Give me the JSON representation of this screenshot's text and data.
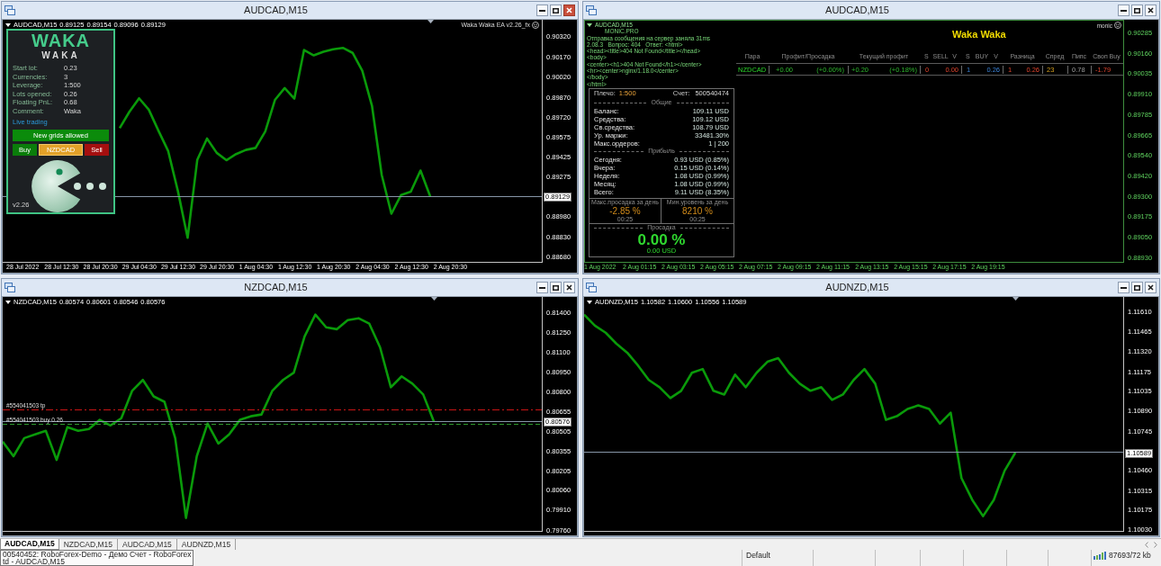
{
  "windows": [
    {
      "kind": "chart",
      "title": "AUDCAD,M15",
      "active": true,
      "header": {
        "symbol": "AUDCAD,M15",
        "ohlc": [
          "0.89125",
          "0.89154",
          "0.89096",
          "0.89129"
        ]
      },
      "ea_label": "Waka Waka EA v2.26_fx",
      "ea_panel": {
        "logo": "WAKA",
        "subtitle": "WAKA",
        "rows": [
          {
            "label": "Start lot:",
            "value": "0.23"
          },
          {
            "label": "Currencies:",
            "value": "3"
          },
          {
            "label": "Leverage:",
            "value": "1:500"
          },
          {
            "label": "Lots opened:",
            "value": "0.26"
          },
          {
            "label": "Floating PnL:",
            "value": "0.68"
          },
          {
            "label": "Comment:",
            "value": "Waka"
          }
        ],
        "status": "Live trading",
        "grid_button": "New grids allowed",
        "buttons": [
          {
            "kind": "buy",
            "label": "Buy"
          },
          {
            "kind": "symbol",
            "label": "NZDCAD"
          },
          {
            "kind": "sell",
            "label": "Sell"
          }
        ],
        "version": "v2.26"
      },
      "chart_data": {
        "type": "line",
        "categories": [
          "28 Jul 2022",
          null,
          null,
          null,
          "28 Jul 12:30",
          null,
          null,
          null,
          "28 Jul 20:30",
          null,
          null,
          null,
          "29 Jul 04:30",
          null,
          null,
          null,
          "29 Jul 12:30",
          null,
          null,
          null,
          "29 Jul 20:30",
          null,
          null,
          null,
          "1 Aug 04:30",
          null,
          null,
          null,
          "1 Aug 12:30",
          null,
          null,
          null,
          "1 Aug 20:30",
          null,
          null,
          null,
          "2 Aug 04:30",
          null,
          null,
          null,
          "2 Aug 12:30",
          null,
          null,
          null,
          "2 Aug 20:30",
          null,
          null,
          null,
          null,
          null,
          null,
          null,
          null,
          null
        ],
        "series": [
          {
            "color": "#0a9a0a",
            "values": [
              null,
              null,
              null,
              null,
              null,
              null,
              null,
              null,
              null,
              null,
              0.8964,
              0.89762,
              0.89863,
              0.89778,
              0.8962,
              0.89468,
              0.89169,
              0.8882,
              0.89404,
              0.89562,
              0.89455,
              0.894,
              0.89446,
              0.89477,
              0.89492,
              0.89615,
              0.89851,
              0.89939,
              0.89861,
              0.90224,
              0.90184,
              0.90211,
              0.9023,
              0.9024,
              0.90203,
              0.90069,
              0.89807,
              0.89291,
              0.89,
              0.8914,
              0.89165,
              0.89323,
              0.89129,
              null,
              null,
              null,
              null,
              null,
              null,
              null,
              null,
              null,
              null,
              null
            ]
          }
        ],
        "ylim": [
          0.8864,
          0.9045
        ],
        "yticks": [
          {
            "value": 0.9032,
            "label": "0.90320"
          },
          {
            "value": 0.9017,
            "label": "0.90170"
          },
          {
            "value": 0.9002,
            "label": "0.90020"
          },
          {
            "value": 0.8987,
            "label": "0.89870"
          },
          {
            "value": 0.8972,
            "label": "0.89720"
          },
          {
            "value": 0.89575,
            "label": "0.89575"
          },
          {
            "value": 0.89425,
            "label": "0.89425"
          },
          {
            "value": 0.89275,
            "label": "0.89275"
          },
          {
            "value": 0.8898,
            "label": "0.88980"
          },
          {
            "value": 0.8883,
            "label": "0.88830"
          },
          {
            "value": 0.8868,
            "label": "0.88680"
          }
        ],
        "ref_lines": [
          {
            "axis": "y",
            "value": 0.89129,
            "label": "0.89129",
            "color": "#8796a8"
          }
        ]
      }
    },
    {
      "kind": "monitor",
      "title": "AUDCAD,M15",
      "active": false,
      "header": {
        "symbol": "AUDCAD,M15"
      },
      "brand": "MONIC.PRO",
      "log": [
        "Отправка сообщения на сервер заняла 31ms",
        "2.08.3   Вопрос: 404   Ответ: <html>",
        "<head><title>404 Not Found</title></head>",
        "<body>",
        "<center><h1>404 Not Found</h1></center>",
        "<hr><center>nginx/1.18.0</center>",
        "</body>",
        "</html>"
      ],
      "stats": {
        "leverage_label": "Плечо:",
        "leverage": "1:500",
        "account_label": "Счет:",
        "account": "500540474",
        "sections": [
          {
            "title": "Общие",
            "rows": [
              {
                "label": "Баланс:",
                "value": "109.11 USD"
              },
              {
                "label": "Средства:",
                "value": "109.12 USD"
              },
              {
                "label": "Св.средства:",
                "value": "108.79 USD"
              },
              {
                "label": "Ур. маржи:",
                "value": "33481.30%"
              },
              {
                "label": "Макс.ордеров:",
                "value": "1 | 200"
              }
            ]
          },
          {
            "title": "Прибыль",
            "rows": [
              {
                "label": "Сегодня:",
                "value": "0.93 USD (0.85%)"
              },
              {
                "label": "Вчера:",
                "value": "0.15 USD (0.14%)"
              },
              {
                "label": "Неделя:",
                "value": "1.08 USD (0.99%)"
              },
              {
                "label": "Месяц:",
                "value": "1.08 USD (0.99%)"
              },
              {
                "label": "Всего:",
                "value": "9.11 USD (8.35%)"
              }
            ]
          }
        ],
        "extremes": [
          {
            "label": "Макс.просадка за день",
            "value": "-2.85 %",
            "time": "00:25"
          },
          {
            "label": "Мин.уровень за день",
            "value": "8210 %",
            "time": "00:25"
          }
        ],
        "drawdown_title": "Просадка",
        "drawdown": "0.00 %",
        "drawdown_usd": "0.00 USD"
      },
      "author": "monic",
      "monitor_title": "Waka Waka",
      "table": {
        "columns": [
          "Пара",
          "Профит/Просадка",
          "Текущий профит",
          "S SELL V",
          "S BUY V",
          "Разница",
          "Спред",
          "Пипс",
          "Своп Buy"
        ],
        "rows": [
          {
            "cells": [
              "NZDCAD",
              "+0.00 (+0.00%)",
              "+0.20 (+0.18%)",
              "0 0.00",
              "1 0.26",
              "1 0.26",
              "23",
              "0.78",
              "-1.79"
            ]
          }
        ]
      },
      "price_axis": [
        "0.90285",
        "0.90160",
        "0.90035",
        "0.89910",
        "0.89785",
        "0.89665",
        "0.89540",
        "0.89420",
        "0.89300",
        "0.89175",
        "0.89050",
        "0.88930"
      ],
      "time_axis": [
        "1 Aug 2022",
        "2 Aug 01:15",
        "2 Aug 03:15",
        "2 Aug 05:15",
        "2 Aug 07:15",
        "2 Aug 09:15",
        "2 Aug 11:15",
        "2 Aug 13:15",
        "2 Aug 15:15",
        "2 Aug 17:15",
        "2 Aug 19:15"
      ]
    },
    {
      "kind": "chart",
      "title": "NZDCAD,M15",
      "active": false,
      "header": {
        "symbol": "NZDCAD,M15",
        "ohlc": [
          "0.80574",
          "0.80601",
          "0.80546",
          "0.80576"
        ]
      },
      "chart_data": {
        "type": "line",
        "series": [
          {
            "color": "#0a9a0a",
            "values": [
              0.80425,
              0.80315,
              0.80452,
              0.8048,
              0.80507,
              0.80287,
              0.80535,
              0.80507,
              0.80521,
              0.8059,
              0.80548,
              0.80603,
              0.80809,
              0.80892,
              0.80768,
              0.80727,
              0.80452,
              0.79848,
              0.80315,
              0.80562,
              0.80411,
              0.8048,
              0.8059,
              0.80617,
              0.80631,
              0.80809,
              0.80892,
              0.80947,
              0.81221,
              0.81386,
              0.8129,
              0.81276,
              0.81345,
              0.81359,
              0.81318,
              0.81139,
              0.80837,
              0.80919,
              0.80864,
              0.80782,
              0.80576,
              null,
              null,
              null,
              null,
              null,
              null,
              null,
              null,
              null,
              null
            ]
          }
        ],
        "ylim": [
          0.7975,
          0.8152
        ],
        "yticks": [
          {
            "value": 0.814,
            "label": "0.81400"
          },
          {
            "value": 0.8125,
            "label": "0.81250"
          },
          {
            "value": 0.811,
            "label": "0.81100"
          },
          {
            "value": 0.8095,
            "label": "0.80950"
          },
          {
            "value": 0.808,
            "label": "0.80800"
          },
          {
            "value": 0.80655,
            "label": "0.80655"
          },
          {
            "value": 0.80505,
            "label": "0.80505"
          },
          {
            "value": 0.80355,
            "label": "0.80355"
          },
          {
            "value": 0.80205,
            "label": "0.80205"
          },
          {
            "value": 0.8006,
            "label": "0.80060"
          },
          {
            "value": 0.7991,
            "label": "0.79910"
          },
          {
            "value": 0.7976,
            "label": "0.79760"
          }
        ],
        "ref_lines": [
          {
            "axis": "y",
            "value": 0.80576,
            "label": "0.80576",
            "color": "#8796a8"
          },
          {
            "axis": "y",
            "value": 0.80668,
            "label": "#554041503 tp",
            "color": "#c81414"
          },
          {
            "axis": "y",
            "value": 0.8056,
            "label": "#554041503 buy 0.26",
            "color": "#2e9a2e"
          }
        ]
      }
    },
    {
      "kind": "chart",
      "title": "AUDNZD,M15",
      "active": false,
      "header": {
        "symbol": "AUDNZD,M15",
        "ohlc": [
          "1.10582",
          "1.10600",
          "1.10556",
          "1.10589"
        ]
      },
      "chart_data": {
        "type": "line",
        "series": [
          {
            "color": "#0a9a0a",
            "values": [
              1.11592,
              1.11512,
              1.1146,
              1.1138,
              1.11315,
              1.11222,
              1.11117,
              1.11064,
              1.10985,
              1.11038,
              1.11169,
              1.11196,
              1.11038,
              1.11011,
              1.11156,
              1.11064,
              1.11169,
              1.11249,
              1.11275,
              1.11169,
              1.1109,
              1.11038,
              1.11064,
              1.10972,
              1.11011,
              1.11117,
              1.11196,
              1.1109,
              1.10827,
              1.10853,
              1.10906,
              1.10932,
              1.10906,
              1.108,
              1.10879,
              1.10404,
              1.10246,
              1.10127,
              1.10246,
              1.10457,
              1.10589,
              null,
              null,
              null,
              null,
              null,
              null,
              null,
              null,
              null,
              null
            ]
          }
        ],
        "ylim": [
          1.1002,
          1.1172
        ],
        "yticks": [
          {
            "value": 1.1161,
            "label": "1.11610"
          },
          {
            "value": 1.11465,
            "label": "1.11465"
          },
          {
            "value": 1.1132,
            "label": "1.11320"
          },
          {
            "value": 1.11175,
            "label": "1.11175"
          },
          {
            "value": 1.11035,
            "label": "1.11035"
          },
          {
            "value": 1.1089,
            "label": "1.10890"
          },
          {
            "value": 1.10745,
            "label": "1.10745"
          },
          {
            "value": 1.1046,
            "label": "1.10460"
          },
          {
            "value": 1.10315,
            "label": "1.10315"
          },
          {
            "value": 1.10175,
            "label": "1.10175"
          },
          {
            "value": 1.1003,
            "label": "1.10030"
          }
        ],
        "ref_lines": [
          {
            "axis": "y",
            "value": 1.10589,
            "label": "1.10589",
            "color": "#8796a8"
          }
        ]
      }
    }
  ],
  "tabs": [
    {
      "label": "AUDCAD,M15",
      "selected": true
    },
    {
      "label": "NZDCAD,M15",
      "selected": false
    },
    {
      "label": "AUDCAD,M15",
      "selected": false
    },
    {
      "label": "AUDNZD,M15",
      "selected": false
    }
  ],
  "tooltip": {
    "lines": [
      "00540452: RoboForex-Demo - Демо Счет - RoboForex",
      "td - AUDCAD,M15"
    ]
  },
  "status_bar": {
    "profile": "Default",
    "traffic": "87693/72 kb"
  }
}
